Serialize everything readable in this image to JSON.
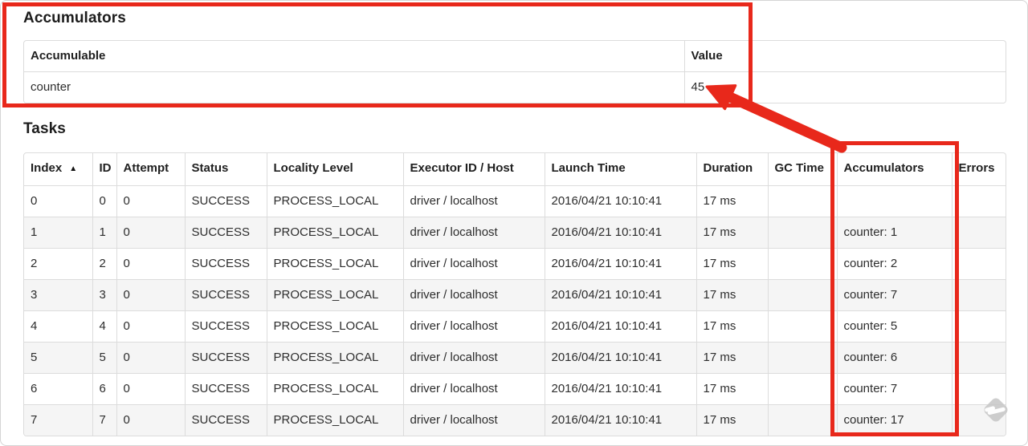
{
  "annotations": {
    "color": "#e8281b"
  },
  "watermark": {
    "icon_color": "#c9c9c9"
  },
  "accumulators_section": {
    "title": "Accumulators",
    "table": {
      "headers": {
        "accumulable": "Accumulable",
        "value": "Value"
      },
      "rows": [
        {
          "accumulable": "counter",
          "value": "45"
        }
      ]
    }
  },
  "tasks_section": {
    "title": "Tasks",
    "table": {
      "sort_icon": "▲",
      "headers": {
        "index": "Index",
        "id": "ID",
        "attempt": "Attempt",
        "status": "Status",
        "locality_level": "Locality Level",
        "executor_id_host": "Executor ID / Host",
        "launch_time": "Launch Time",
        "duration": "Duration",
        "gc_time": "GC Time",
        "accumulators": "Accumulators",
        "errors": "Errors"
      },
      "rows": [
        {
          "index": "0",
          "id": "0",
          "attempt": "0",
          "status": "SUCCESS",
          "locality_level": "PROCESS_LOCAL",
          "executor_id_host": "driver / localhost",
          "launch_time": "2016/04/21 10:10:41",
          "duration": "17 ms",
          "gc_time": "",
          "accumulators": "",
          "errors": ""
        },
        {
          "index": "1",
          "id": "1",
          "attempt": "0",
          "status": "SUCCESS",
          "locality_level": "PROCESS_LOCAL",
          "executor_id_host": "driver / localhost",
          "launch_time": "2016/04/21 10:10:41",
          "duration": "17 ms",
          "gc_time": "",
          "accumulators": "counter: 1",
          "errors": ""
        },
        {
          "index": "2",
          "id": "2",
          "attempt": "0",
          "status": "SUCCESS",
          "locality_level": "PROCESS_LOCAL",
          "executor_id_host": "driver / localhost",
          "launch_time": "2016/04/21 10:10:41",
          "duration": "17 ms",
          "gc_time": "",
          "accumulators": "counter: 2",
          "errors": ""
        },
        {
          "index": "3",
          "id": "3",
          "attempt": "0",
          "status": "SUCCESS",
          "locality_level": "PROCESS_LOCAL",
          "executor_id_host": "driver / localhost",
          "launch_time": "2016/04/21 10:10:41",
          "duration": "17 ms",
          "gc_time": "",
          "accumulators": "counter: 7",
          "errors": ""
        },
        {
          "index": "4",
          "id": "4",
          "attempt": "0",
          "status": "SUCCESS",
          "locality_level": "PROCESS_LOCAL",
          "executor_id_host": "driver / localhost",
          "launch_time": "2016/04/21 10:10:41",
          "duration": "17 ms",
          "gc_time": "",
          "accumulators": "counter: 5",
          "errors": ""
        },
        {
          "index": "5",
          "id": "5",
          "attempt": "0",
          "status": "SUCCESS",
          "locality_level": "PROCESS_LOCAL",
          "executor_id_host": "driver / localhost",
          "launch_time": "2016/04/21 10:10:41",
          "duration": "17 ms",
          "gc_time": "",
          "accumulators": "counter: 6",
          "errors": ""
        },
        {
          "index": "6",
          "id": "6",
          "attempt": "0",
          "status": "SUCCESS",
          "locality_level": "PROCESS_LOCAL",
          "executor_id_host": "driver / localhost",
          "launch_time": "2016/04/21 10:10:41",
          "duration": "17 ms",
          "gc_time": "",
          "accumulators": "counter: 7",
          "errors": ""
        },
        {
          "index": "7",
          "id": "7",
          "attempt": "0",
          "status": "SUCCESS",
          "locality_level": "PROCESS_LOCAL",
          "executor_id_host": "driver / localhost",
          "launch_time": "2016/04/21 10:10:41",
          "duration": "17 ms",
          "gc_time": "",
          "accumulators": "counter: 17",
          "errors": ""
        }
      ]
    }
  }
}
